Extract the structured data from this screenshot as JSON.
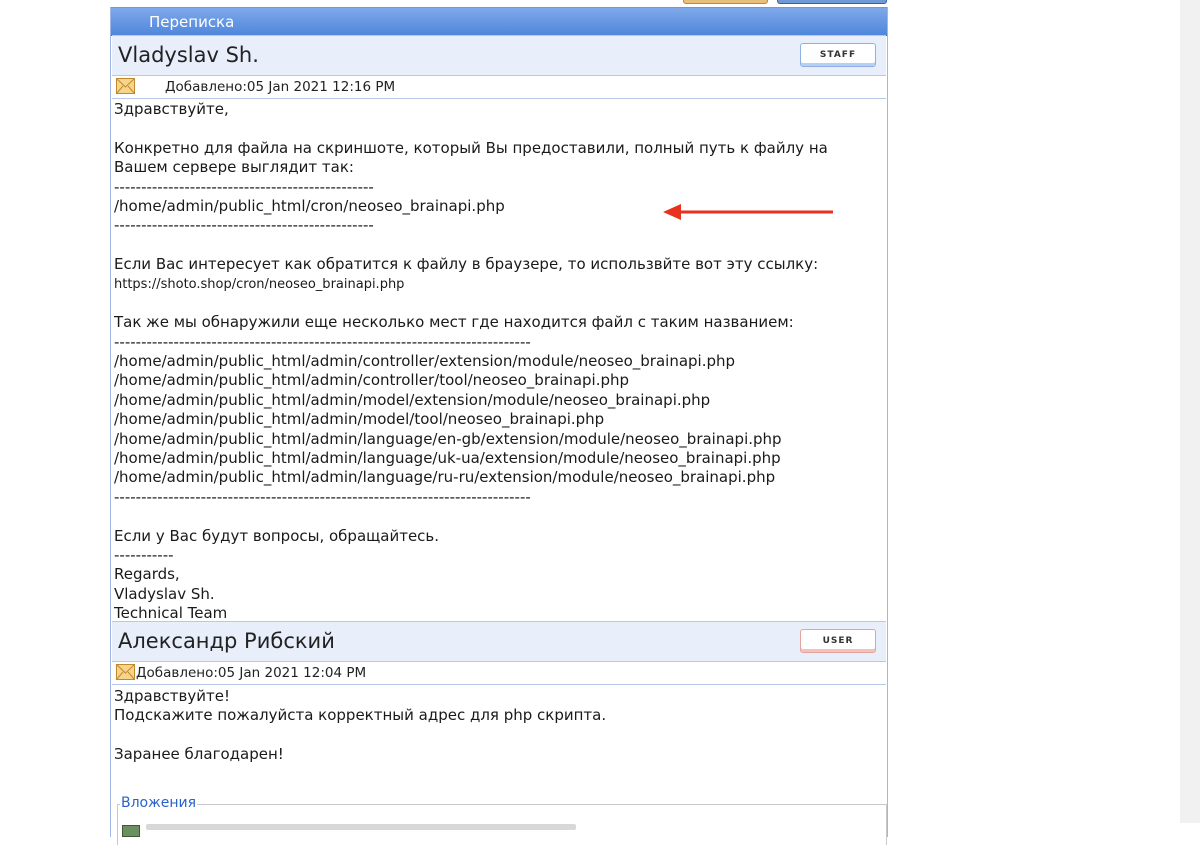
{
  "section": {
    "title": "Переписка"
  },
  "messages": [
    {
      "author": "Vladyslav Sh.",
      "role": "STAFF",
      "date_label": "Добавлено:05 Jan 2021 12:16 PM",
      "lines": [
        "Здравствуйте,",
        "",
        "Конкретно для файла на скриншоте, который Вы предоставили, полный путь к файлу на",
        "Вашем сервере выглядит так:",
        "------------------------------------------------",
        "/home/admin/public_html/cron/neoseo_brainapi.php",
        "------------------------------------------------",
        "",
        "Если Вас интересует как обратится к файлу в браузере, то использвйте вот эту ссылку:",
        "https://shoto.shop/cron/neoseo_brainapi.php",
        "",
        "Так же мы обнаружили еще несколько мест где находится файл с таким названием:",
        "-----------------------------------------------------------------------------",
        "/home/admin/public_html/admin/controller/extension/module/neoseo_brainapi.php",
        "/home/admin/public_html/admin/controller/tool/neoseo_brainapi.php",
        "/home/admin/public_html/admin/model/extension/module/neoseo_brainapi.php",
        "/home/admin/public_html/admin/model/tool/neoseo_brainapi.php",
        "/home/admin/public_html/admin/language/en-gb/extension/module/neoseo_brainapi.php",
        "/home/admin/public_html/admin/language/uk-ua/extension/module/neoseo_brainapi.php",
        "/home/admin/public_html/admin/language/ru-ru/extension/module/neoseo_brainapi.php",
        "-----------------------------------------------------------------------------",
        "",
        "Если у Вас будут вопросы, обращайтесь.",
        "-----------",
        "Regards,",
        "Vladyslav Sh.",
        "Technical Team"
      ]
    },
    {
      "author": "Александр Рибский",
      "role": "USER",
      "date_label": "Добавлено:05 Jan 2021 12:04 PM",
      "lines": [
        "Здравствуйте!",
        "Подскажите пожалуйста корректный адрес для php скрипта.",
        "",
        "Заранее благодарен!"
      ],
      "attachments_label": "Вложения"
    }
  ],
  "colors": {
    "header_blue": "#4f86dc",
    "post_head_bg": "#e9eefb",
    "arrow_red": "#e8321e",
    "attachments_blue": "#2a62c9"
  }
}
